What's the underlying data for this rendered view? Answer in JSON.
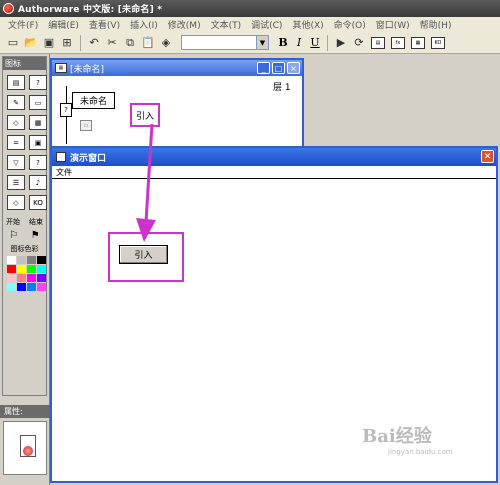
{
  "window": {
    "title": "Authorware 中文版: [未命名] *"
  },
  "menu": {
    "items": [
      "文件(F)",
      "编辑(E)",
      "查看(V)",
      "插入(I)",
      "修改(M)",
      "文本(T)",
      "调试(C)",
      "其他(X)",
      "命令(O)",
      "窗口(W)",
      "帮助(H)"
    ]
  },
  "toolbar": {
    "bold": "B",
    "italic": "I",
    "underline": "U"
  },
  "palette": {
    "title": "图标",
    "start_label": "开始",
    "end_label": "结束",
    "colors_label": "图标色彩",
    "colors": [
      "#ffffff",
      "#c0c0c0",
      "#808080",
      "#000000",
      "#ff0000",
      "#ffff00",
      "#00ff00",
      "#00ffff",
      "#ffc0cb",
      "#ff8080",
      "#ff00ff",
      "#8000ff",
      "#80ffff",
      "#0000ff",
      "#0080ff",
      "#ff40ff"
    ]
  },
  "properties": {
    "title": "属性:"
  },
  "design": {
    "title": "[未命名]",
    "layer": "层 1",
    "icon_label": "未命名",
    "callout_label": "引入"
  },
  "presentation": {
    "title": "演示窗口",
    "menu_file": "文件",
    "button_label": "引入"
  },
  "watermark": {
    "text": "Bai经验",
    "url": "jingyan.baidu.com"
  }
}
